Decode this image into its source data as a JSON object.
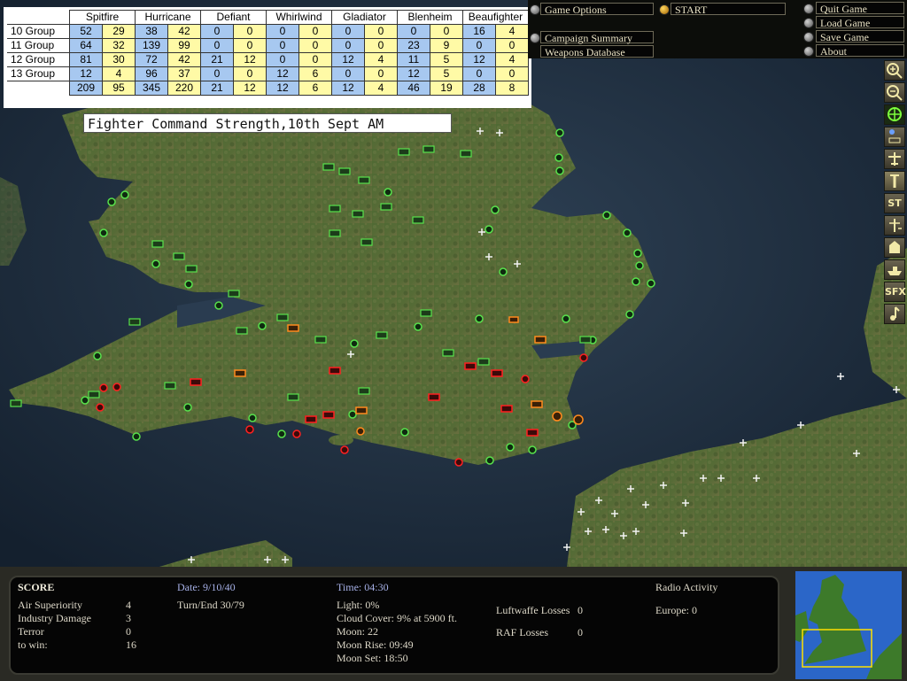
{
  "strength_table": {
    "columns": [
      "Spitfire",
      "Hurricane",
      "Defiant",
      "Whirlwind",
      "Gladiator",
      "Blenheim",
      "Beaufighter"
    ],
    "rows": [
      {
        "label": "10 Group",
        "values": [
          "52",
          "29",
          "38",
          "42",
          "0",
          "0",
          "0",
          "0",
          "0",
          "0",
          "0",
          "0",
          "16",
          "4"
        ]
      },
      {
        "label": "11 Group",
        "values": [
          "64",
          "32",
          "139",
          "99",
          "0",
          "0",
          "0",
          "0",
          "0",
          "0",
          "23",
          "9",
          "0",
          "0"
        ]
      },
      {
        "label": "12 Group",
        "values": [
          "81",
          "30",
          "72",
          "42",
          "21",
          "12",
          "0",
          "0",
          "12",
          "4",
          "11",
          "5",
          "12",
          "4"
        ]
      },
      {
        "label": "13 Group",
        "values": [
          "12",
          "4",
          "96",
          "37",
          "0",
          "0",
          "12",
          "6",
          "0",
          "0",
          "12",
          "5",
          "0",
          "0"
        ]
      }
    ],
    "totals": [
      "209",
      "95",
      "345",
      "220",
      "21",
      "12",
      "12",
      "6",
      "12",
      "4",
      "46",
      "19",
      "28",
      "8"
    ]
  },
  "caption": "Fighter Command Strength,10th Sept AM",
  "menu": {
    "game_options": "Game Options",
    "start": "START",
    "quit_game": "Quit Game",
    "load_game": "Load Game",
    "save_game": "Save Game",
    "about": "About",
    "campaign_summary": "Campaign Summary",
    "weapons_database": "Weapons Database"
  },
  "toolbar": {
    "st": "ST",
    "sfx": "SFX"
  },
  "score": {
    "title": "SCORE",
    "air_superiority_label": "Air Superiority",
    "air_superiority": "4",
    "industry_damage_label": "Industry Damage",
    "industry_damage": "3",
    "terror_label": "Terror",
    "terror": "0",
    "to_win_label": "to win:",
    "to_win": "16"
  },
  "status": {
    "date": "Date: 9/10/40",
    "turn": "Turn/End  30/79",
    "time": "Time: 04:30",
    "light": "Light: 0%",
    "cloud": "Cloud Cover: 9% at 5900 ft.",
    "moon": "Moon: 22",
    "moon_rise": "Moon Rise: 09:49",
    "moon_set": "Moon Set: 18:50",
    "luftwaffe_losses_label": "Luftwaffe Losses",
    "luftwaffe_losses": "0",
    "raf_losses_label": "RAF Losses",
    "raf_losses": "0",
    "radio_activity": "Radio Activity",
    "europe": "Europe: 0"
  },
  "colors": {
    "raf": "#58e24c",
    "damaged": "#ff8a1e",
    "destroyed": "#ff2020",
    "luftwaffe": "#f2f2f2"
  }
}
